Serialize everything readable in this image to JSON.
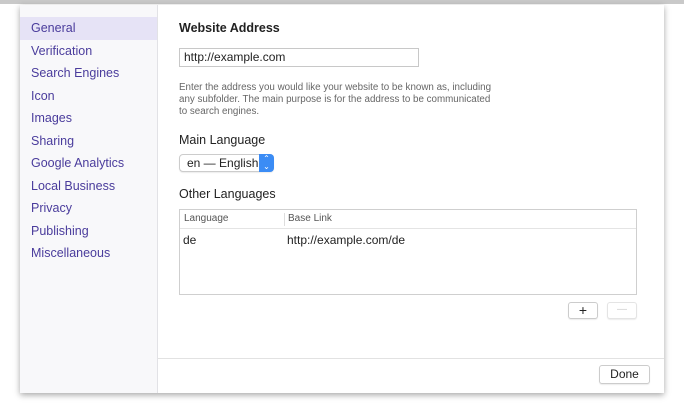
{
  "sidebar": {
    "items": [
      {
        "label": "General",
        "selected": true
      },
      {
        "label": "Verification"
      },
      {
        "label": "Search Engines"
      },
      {
        "label": "Icon"
      },
      {
        "label": "Images"
      },
      {
        "label": "Sharing"
      },
      {
        "label": "Google Analytics"
      },
      {
        "label": "Local Business"
      },
      {
        "label": "Privacy"
      },
      {
        "label": "Publishing"
      },
      {
        "label": "Miscellaneous"
      }
    ]
  },
  "main": {
    "website_address_label": "Website Address",
    "website_address_value": "http://example.com",
    "help_text": "Enter the address you would like your website to be known as, including any subfolder. The main purpose is for the address to be communicated to search engines.",
    "main_language_label": "Main Language",
    "main_language_value": "en — English",
    "other_languages_label": "Other Languages",
    "table": {
      "columns": [
        "Language",
        "Base Link"
      ],
      "rows": [
        [
          "de",
          "http://example.com/de"
        ]
      ]
    },
    "add_label": "+",
    "remove_label": "—"
  },
  "footer": {
    "done_label": "Done"
  },
  "colors": {
    "accent": "#4a3c9c",
    "selected_bg": "#e6e3f6",
    "stepper": "#3b8cf5"
  }
}
